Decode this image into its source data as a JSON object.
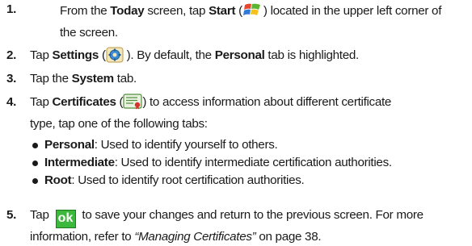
{
  "steps": [
    {
      "number": "1.",
      "line1_a": "From the ",
      "bold_today": "Today",
      "line1_b": " screen, tap ",
      "bold_start": "Start",
      "line1_c": " (",
      "line1_d": ") located in the upper left corner of",
      "line2": "the screen."
    },
    {
      "number": "2.",
      "a": "Tap ",
      "bold_settings": "Settings",
      "b": " (",
      "c": " ). By default, the ",
      "bold_personal": "Personal",
      "d": " tab is highlighted."
    },
    {
      "number": "3.",
      "a": "Tap the ",
      "bold_system": "System",
      "b": " tab."
    },
    {
      "number": "4.",
      "a": "Tap ",
      "bold_certificates": "Certificates",
      "b": " (",
      "c": ") to access information about different certificate",
      "line2": "type, tap one of the following tabs:",
      "bullets": [
        {
          "term": "Personal",
          "desc": ": Used to identify yourself to others."
        },
        {
          "term": "Intermediate",
          "desc": ": Used to identify intermediate certification authorities."
        },
        {
          "term": "Root",
          "desc": ": Used to identify root certification authorities."
        }
      ]
    },
    {
      "number": "5.",
      "a": "Tap ",
      "ok_label": "ok",
      "b": " to save your changes and return to the previous screen. For more",
      "line2_a": "information, refer to ",
      "link": "“Managing Certificates”",
      "line2_b": " on page 38."
    }
  ],
  "icons": {
    "start": "windows-start-icon",
    "settings": "settings-gear-icon",
    "certificates": "certificates-icon",
    "ok_color": "#3cb83c"
  }
}
